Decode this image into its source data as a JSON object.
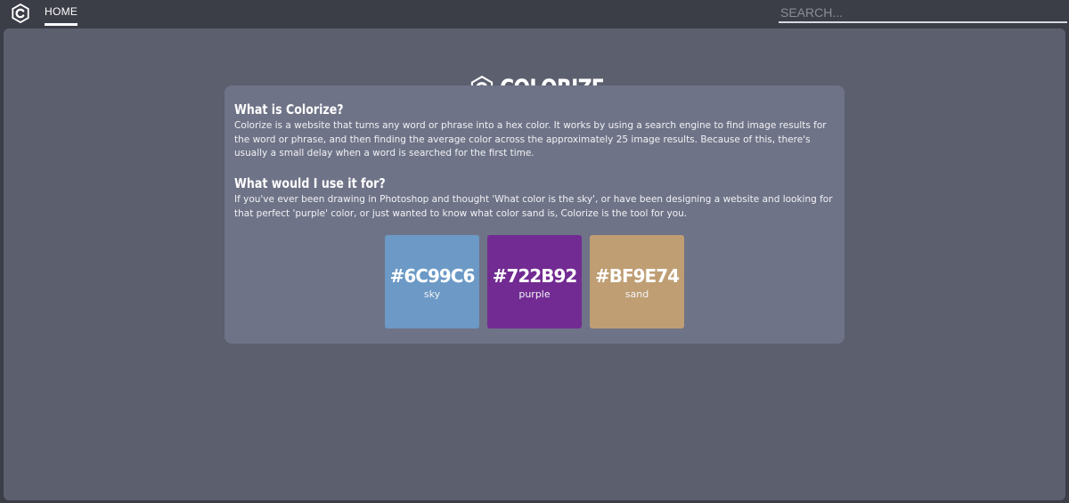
{
  "nav": {
    "home_label": "HOME",
    "search_placeholder": "SEARCH..."
  },
  "brand": {
    "name": "COLORIZE",
    "logo_icon": "colorize-c-logo-icon"
  },
  "info": {
    "what_title": "What is Colorize?",
    "what_body": "Colorize is a website that turns any word or phrase into a hex color. It works by using a search engine to find image results for the word or phrase, and then finding the average color across the approximately 25 image results. Because of this, there's usually a small delay when a word is searched for the first time.",
    "use_title": "What would I use it for?",
    "use_body": "If you've ever been drawing in Photoshop and thought 'What color is the sky', or have been designing a website and looking for that perfect 'purple' color, or just wanted to know what color sand is, Colorize is the tool for you."
  },
  "swatches": [
    {
      "hex": "#6C99C6",
      "word": "sky",
      "color": "#6C99C6"
    },
    {
      "hex": "#722B92",
      "word": "purple",
      "color": "#722B92"
    },
    {
      "hex": "#BF9E74",
      "word": "sand",
      "color": "#BF9E74"
    }
  ],
  "colors": {
    "topbar": "#3b3d47",
    "background": "#5b5f6e",
    "card": "#6f7387"
  }
}
